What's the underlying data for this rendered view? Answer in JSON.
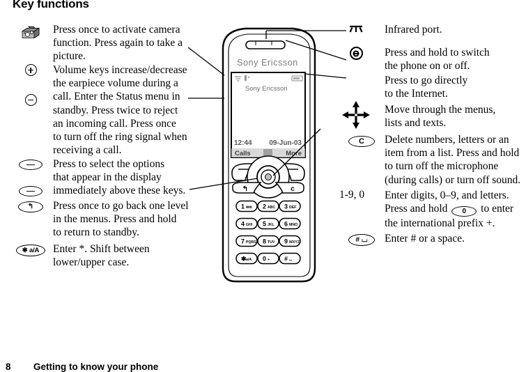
{
  "page": {
    "title": "Key functions",
    "footer_page_number": "8",
    "footer_section_title": "Getting to know your phone"
  },
  "left_column": {
    "entries": [
      {
        "icon": "camera-icon",
        "icon_label": "",
        "lines": [
          "Press once to activate camera",
          "function. Press again to take a",
          "picture."
        ]
      },
      {
        "icon": "volume-up-icon",
        "icon_label": "+",
        "lines": [
          "Volume keys increase/decrease",
          "the earpiece volume during a",
          "call. Enter the Status menu in",
          "standby. Press twice to reject",
          "an incoming call. Press once",
          "to turn off the ring signal when",
          "receiving a call."
        ]
      },
      {
        "icon": "volume-down-icon",
        "icon_label": "−",
        "lines": []
      },
      {
        "icon": "left-selection-key-icon",
        "icon_label": "",
        "lines": [
          "Press to select the options",
          "that appear in the display",
          "immediately above these keys."
        ]
      },
      {
        "icon": "right-selection-key-icon",
        "icon_label": "",
        "lines": []
      },
      {
        "icon": "back-key-icon",
        "icon_label": "↰",
        "lines": [
          "Press once to go back one level",
          "in the menus. Press and hold",
          "to return to standby."
        ]
      },
      {
        "icon": "star-shift-key-icon",
        "icon_label": "✱ a/A",
        "lines": [
          "Enter *. Shift between",
          "lower/upper case."
        ]
      }
    ]
  },
  "right_column": {
    "entries": [
      {
        "icon": "infrared-port-icon",
        "icon_label": "",
        "lines": [
          "Infrared port."
        ]
      },
      {
        "icon": "power-key-icon",
        "icon_label": "",
        "lines": [
          "Press and hold to switch",
          "the phone on or off."
        ]
      },
      {
        "icon": "internet-key-icon",
        "icon_label": "",
        "lines": [
          "Press to go directly",
          "to the Internet."
        ]
      },
      {
        "icon": "navigation-key-icon",
        "icon_label": "",
        "lines": [
          "Move through the menus,",
          "lists and texts."
        ]
      },
      {
        "icon": "clear-key-icon",
        "icon_label": "C",
        "lines": [
          "Delete numbers, letters or an",
          "item from a list. Press and hold",
          "to turn off the microphone",
          "(during calls) or turn off sound."
        ]
      },
      {
        "icon": "digit-keys-label",
        "icon_label": "1-9, 0",
        "lines_rich": {
          "line1": "Enter digits, 0–9, and letters.",
          "line2_before": "Press and hold",
          "line2_key": "0",
          "line2_after": "to enter",
          "line3": "the international prefix +."
        }
      },
      {
        "icon": "hash-key-icon",
        "icon_label": "# ⌴",
        "lines": [
          "Enter # or a space."
        ]
      }
    ]
  },
  "phone": {
    "brand": "Sony Ericsson",
    "screen": {
      "operator": "Sony Ericsson",
      "time": "12:44",
      "date": "09-Jun-03",
      "softkey_left": "Calls",
      "softkey_right": "More"
    },
    "keypad": {
      "soft_left_label": "",
      "back_label": "↰",
      "clear_label": "c",
      "keys": [
        {
          "digit": "1",
          "letters": "✉✉"
        },
        {
          "digit": "2",
          "letters": "ABC"
        },
        {
          "digit": "3",
          "letters": "DEF"
        },
        {
          "digit": "4",
          "letters": "GHI"
        },
        {
          "digit": "5",
          "letters": "JKL"
        },
        {
          "digit": "6",
          "letters": "MNO"
        },
        {
          "digit": "7",
          "letters": "PQRS"
        },
        {
          "digit": "8",
          "letters": "TUV"
        },
        {
          "digit": "9",
          "letters": "WXYZ"
        },
        {
          "digit": "✱",
          "letters": "a/A"
        },
        {
          "digit": "0",
          "letters": "+"
        },
        {
          "digit": "#",
          "letters": "⌴"
        }
      ]
    }
  },
  "colors": {
    "ink": "#000000",
    "paper": "#ffffff",
    "brand_text": "#6a6a6a",
    "screen_bg": "#ffffff",
    "screen_border": "#000000"
  }
}
